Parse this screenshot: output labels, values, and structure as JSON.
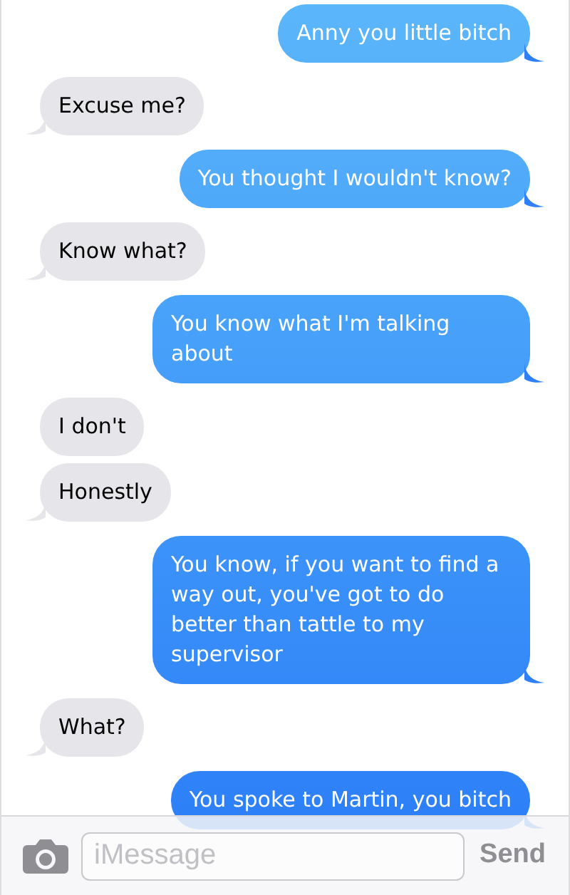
{
  "messages": [
    {
      "kind": "sent",
      "text": "Anny you little bitch",
      "tail": true
    },
    {
      "kind": "received",
      "text": "Excuse me?",
      "tail": true
    },
    {
      "kind": "sent",
      "text": "You thought I wouldn't know?",
      "tail": true
    },
    {
      "kind": "received",
      "text": "Know what?",
      "tail": true
    },
    {
      "kind": "sent",
      "text": "You know what I'm talking about",
      "tail": true
    },
    {
      "kind": "received",
      "text": "I don't",
      "tail": false
    },
    {
      "kind": "received",
      "text": "Honestly",
      "tail": true
    },
    {
      "kind": "sent",
      "text": "You know, if you want to find a way out, you've got to do better than tattle to my supervisor",
      "tail": true
    },
    {
      "kind": "received",
      "text": "What?",
      "tail": true
    },
    {
      "kind": "sent",
      "text": "You spoke to Martin, you bitch",
      "tail": true
    }
  ],
  "composer": {
    "placeholder": "iMessage",
    "send": "Send"
  }
}
